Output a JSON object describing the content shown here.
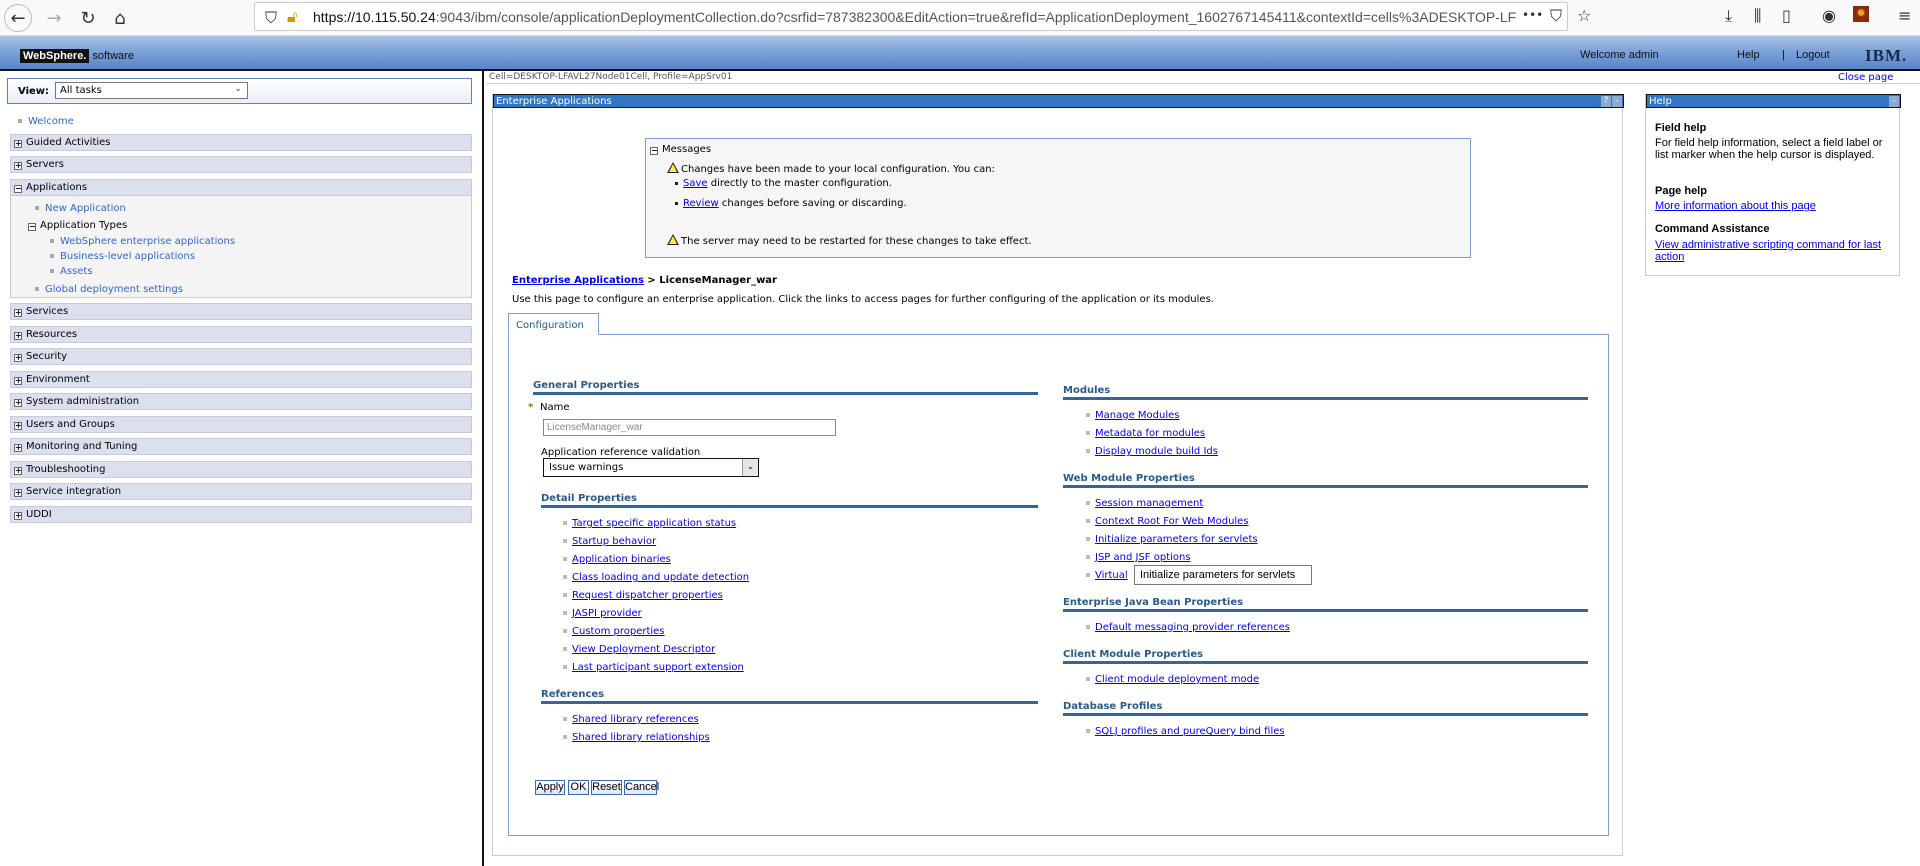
{
  "browser": {
    "url_host": "https://10.115.50.24",
    "url_rest": ":9043/ibm/console/applicationDeploymentCollection.do?csrfid=787382300&EditAction=true&refId=ApplicationDeployment_1602767145411&contextId=cells%3ADESKTOP-LF",
    "more": "•••"
  },
  "banner": {
    "logo_brand": "WebSphere.",
    "logo_suffix": "software",
    "welcome": "Welcome admin",
    "help": "Help",
    "separator": "|",
    "logout": "Logout",
    "ibm": "IBM."
  },
  "context": {
    "cell": "Cell=DESKTOP-LFAVL27Node01Cell, Profile=AppSrv01",
    "close_page": "Close page"
  },
  "sidebar": {
    "view_label": "View:",
    "view_value": "All tasks",
    "welcome": "Welcome",
    "categories": [
      "Guided Activities",
      "Servers",
      "Applications",
      "Services",
      "Resources",
      "Security",
      "Environment",
      "System administration",
      "Users and Groups",
      "Monitoring and Tuning",
      "Troubleshooting",
      "Service integration",
      "UDDI"
    ],
    "applications": {
      "new_application": "New Application",
      "application_types": "Application Types",
      "types": [
        "WebSphere enterprise applications",
        "Business-level applications",
        "Assets"
      ],
      "global_deployment": "Global deployment settings"
    }
  },
  "main": {
    "panel_title": "Enterprise Applications",
    "help_btn": "?",
    "min_btn": "-",
    "messages": {
      "title": "Messages",
      "changes": "Changes have been made to your local configuration. You can:",
      "save_link": "Save",
      "save_rest": " directly to the master configuration.",
      "review_link": "Review",
      "review_rest": " changes before saving or discarding.",
      "restart": "The server may need to be restarted for these changes to take effect."
    },
    "breadcrumb_link": "Enterprise Applications",
    "breadcrumb_current": " > LicenseManager_war",
    "description": "Use this page to configure an enterprise application. Click the links to access pages for further configuring of the application or its modules.",
    "tab": "Configuration",
    "general_properties": "General Properties",
    "required_mark": "*",
    "name_label": "Name",
    "name_value": "LicenseManager_war",
    "ref_validation_label": "Application reference validation",
    "ref_validation_value": "Issue warnings",
    "detail_properties": {
      "title": "Detail Properties",
      "links": [
        "Target specific application status",
        "Startup behavior",
        "Application binaries",
        "Class loading and update detection",
        "Request dispatcher properties",
        "JASPI provider",
        "Custom properties",
        "View Deployment Descriptor",
        "Last participant support extension"
      ]
    },
    "references": {
      "title": "References",
      "links": [
        "Shared library references",
        "Shared library relationships"
      ]
    },
    "modules": {
      "title": "Modules",
      "links": [
        "Manage Modules",
        "Metadata for modules",
        "Display module build Ids"
      ]
    },
    "web_module": {
      "title": "Web Module Properties",
      "links": [
        "Session management",
        "Context Root For Web Modules",
        "Initialize parameters for servlets",
        "JSP and JSF options",
        "Virtual"
      ]
    },
    "ejb": {
      "title": "Enterprise Java Bean Properties",
      "links": [
        "Default messaging provider references"
      ]
    },
    "client_module": {
      "title": "Client Module Properties",
      "links": [
        "Client module deployment mode"
      ]
    },
    "database_profiles": {
      "title": "Database Profiles",
      "links": [
        "SQLJ profiles and pureQuery bind files"
      ]
    },
    "tooltip": "Initialize parameters for servlets",
    "buttons": {
      "apply": "Apply",
      "ok": "OK",
      "reset": "Reset",
      "cancel": "Cancel"
    }
  },
  "help": {
    "title": "Help",
    "field_help_title": "Field help",
    "field_help_text": "For field help information, select a field label or list marker when the help cursor is displayed.",
    "page_help_title": "Page help",
    "page_help_link": "More information about this page",
    "command_title": "Command Assistance",
    "command_link": "View administrative scripting command for last action"
  }
}
